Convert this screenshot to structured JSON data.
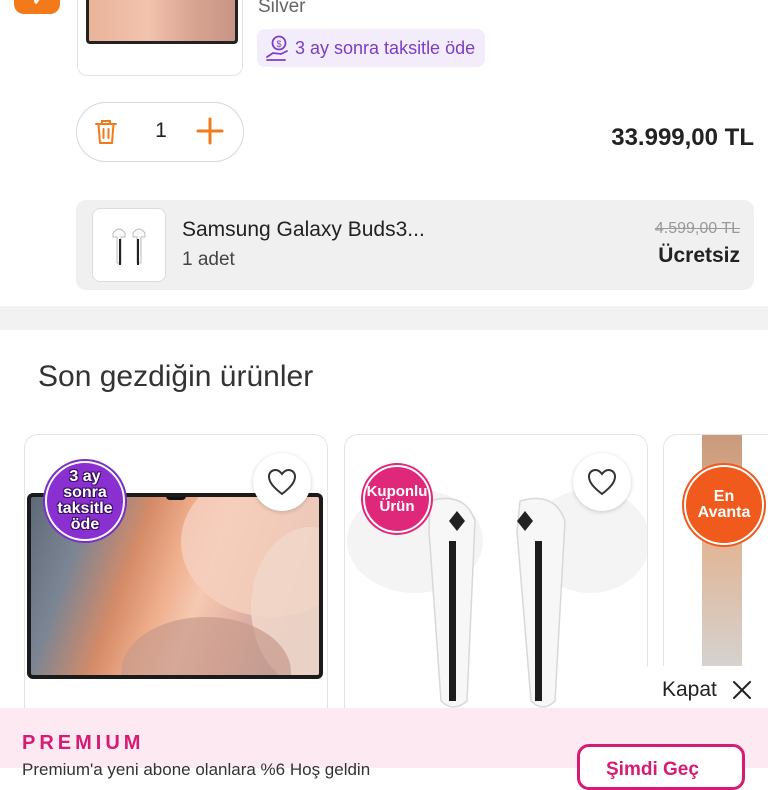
{
  "cart_item": {
    "variant": "Silver",
    "installment_badge": "3 ay sonra taksitle öde",
    "quantity": "1",
    "price": "33.999,00 TL"
  },
  "gift_item": {
    "name": "Samsung Galaxy Buds3...",
    "count": "1 adet",
    "old_price": "4.599,00 TL",
    "new_price": "Ücretsiz"
  },
  "recent": {
    "title": "Son gezdiğin ürünler",
    "cards": [
      {
        "badge_lines": [
          "3 ay",
          "sonra",
          "taksitle",
          "öde"
        ]
      },
      {
        "badge_lines": [
          "Kuponlu",
          "Ürün"
        ]
      },
      {
        "badge_lines": [
          "En",
          "Avanta"
        ]
      }
    ]
  },
  "close_label": "Kapat",
  "premium": {
    "title": "PREMIUM",
    "subtitle": "Premium'a yeni abone olanlara %6 Hoş geldin",
    "button": "Şimdi Geç"
  },
  "colors": {
    "brand_orange": "#f27a1a",
    "purple": "#7b3fc4",
    "premium_pink": "#d61b74"
  },
  "icons": [
    "chevron-down-icon",
    "coin-hand-icon",
    "trash-icon",
    "plus-icon",
    "heart-icon",
    "close-icon"
  ]
}
